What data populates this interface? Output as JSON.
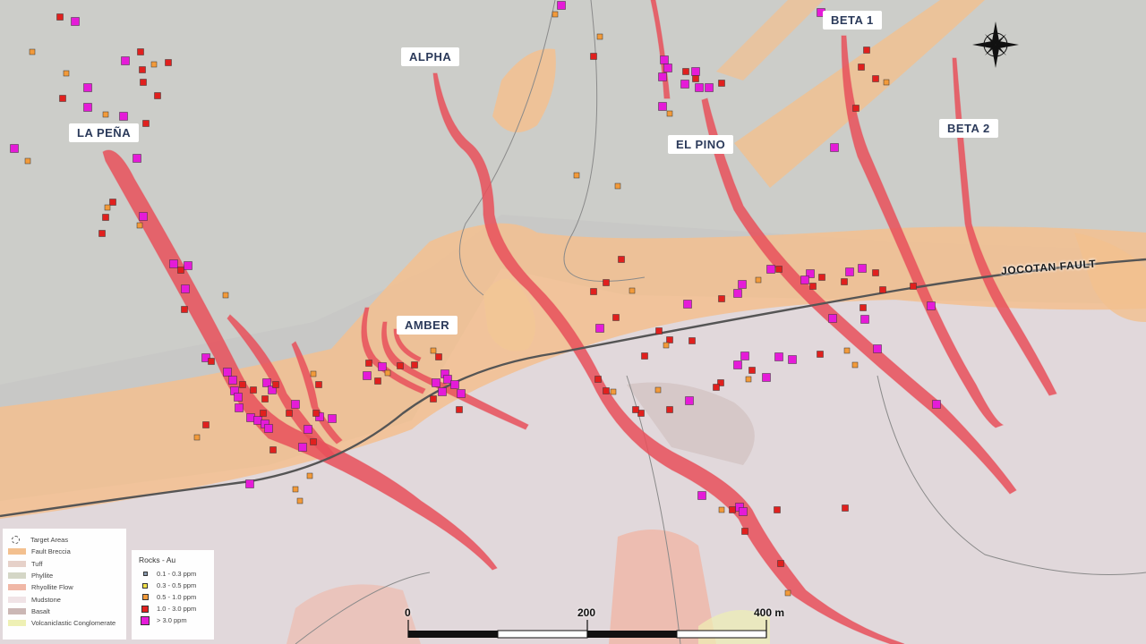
{
  "map": {
    "targets": [
      "LA PEÑA",
      "ALPHA",
      "EL PINO",
      "BETA 1",
      "BETA 2",
      "AMBER"
    ],
    "fault_label": "JOCOTAN FAULT"
  },
  "legend_geology": {
    "items": [
      {
        "label": "Target Areas",
        "swatch": "ring"
      },
      {
        "label": "Fault Breccia",
        "color": "#f3c08f"
      },
      {
        "label": "Tuff",
        "color": "#e6d1c9"
      },
      {
        "label": "Phyllite",
        "color": "#d4d6c6"
      },
      {
        "label": "Rhyollite Flow",
        "color": "#f0b7a6"
      },
      {
        "label": "Mudstone",
        "color": "#f0e3e6"
      },
      {
        "label": "Basalt",
        "color": "#cbb7b5"
      },
      {
        "label": "Volcaniclastic Conglomerate",
        "color": "#eef0b4"
      }
    ]
  },
  "legend_rocks": {
    "title": "Rocks - Au",
    "items": [
      {
        "label": "0.1 - 0.3 ppm",
        "color": "#8a9bb0",
        "size": 3
      },
      {
        "label": "0.3 - 0.5 ppm",
        "color": "#f2e24a",
        "size": 4
      },
      {
        "label": "0.5 - 1.0 ppm",
        "color": "#f29a3a",
        "size": 5
      },
      {
        "label": "1.0 - 3.0 ppm",
        "color": "#e0201e",
        "size": 6
      },
      {
        "label": "> 3.0 ppm",
        "color": "#e51bd8",
        "size": 8
      }
    ]
  },
  "scale": {
    "labels": [
      "0",
      "200",
      "400 m"
    ]
  },
  "colors": {
    "fault_breccia": "#f3c08f",
    "vein": "#e8505a",
    "fault_line": "#555555",
    "background": "#c9c9c7"
  }
}
